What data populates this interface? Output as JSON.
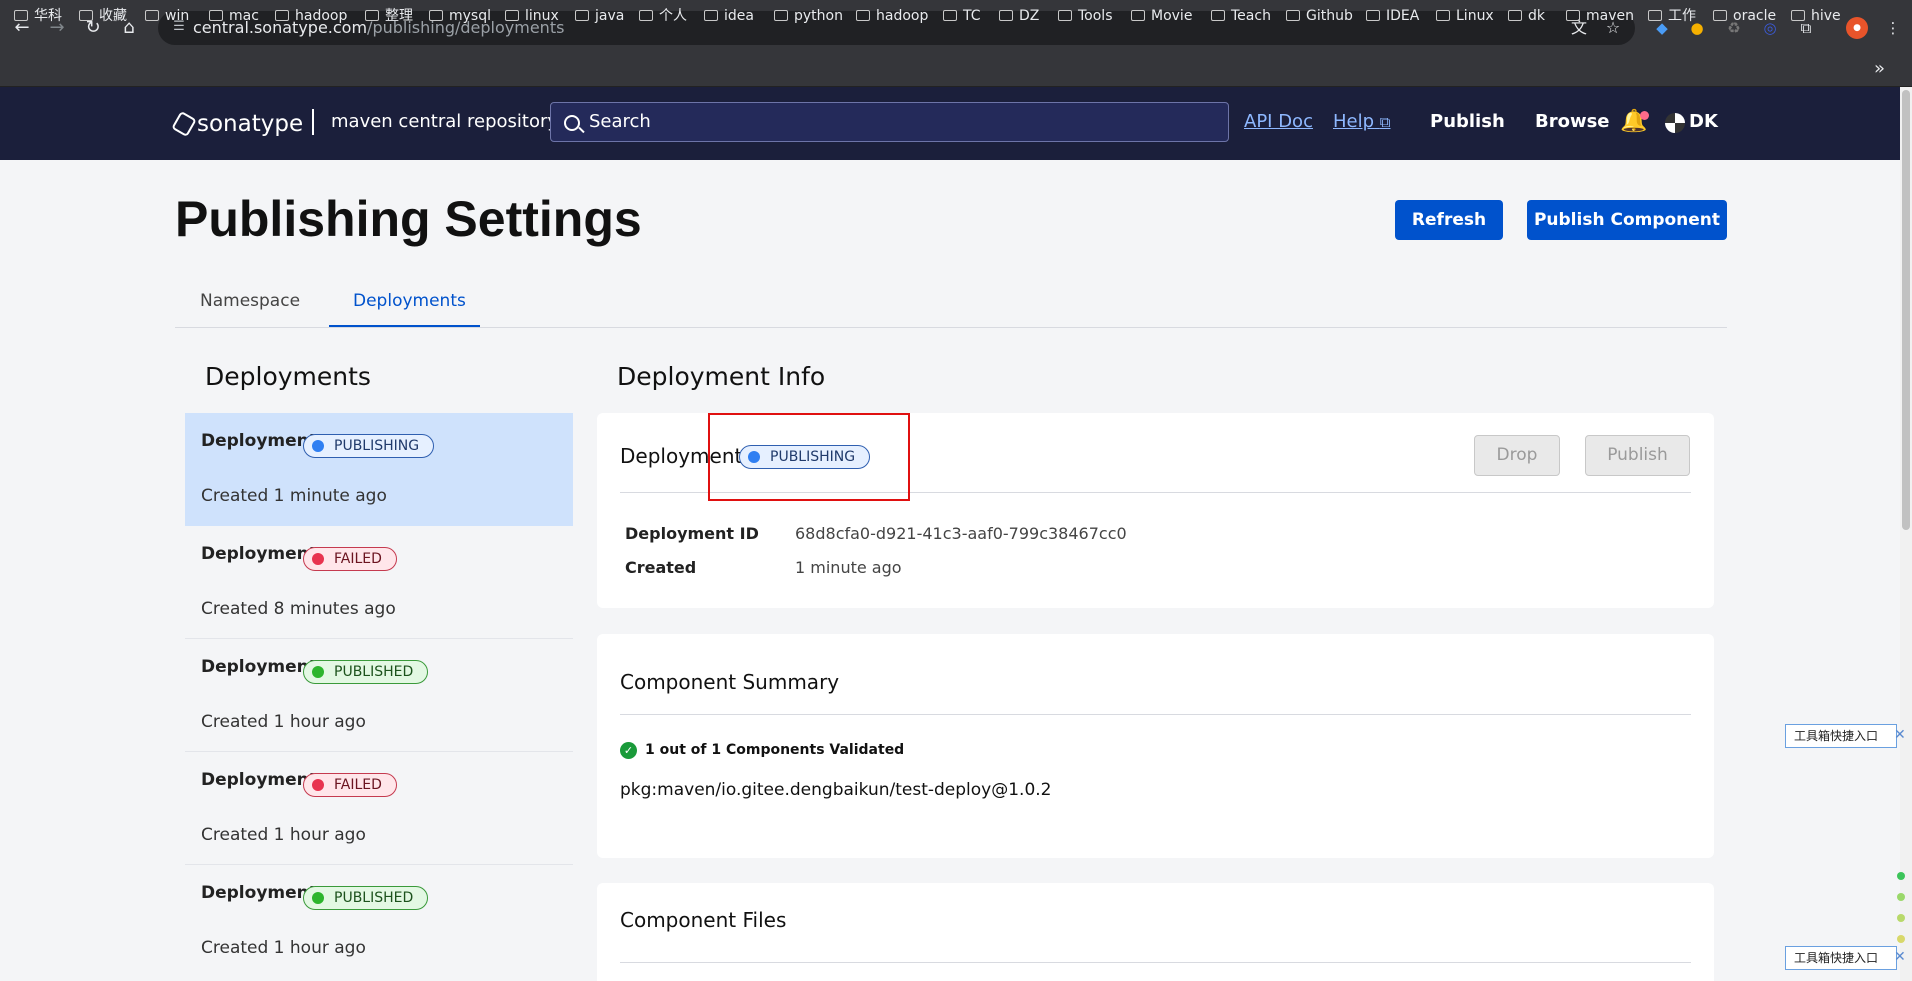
{
  "browser": {
    "url_host": "central.sonatype.com",
    "url_path": "/publishing/deployments",
    "bookmarks": [
      "华科",
      "收藏",
      "win",
      "mac",
      "hadoop",
      "整理",
      "mysql",
      "linux",
      "java",
      "个人",
      "idea",
      "python",
      "hadoop",
      "TC",
      "DZ",
      "Tools",
      "Movie",
      "Teach",
      "Github",
      "IDEA",
      "Linux",
      "dk",
      "maven",
      "工作",
      "oracle",
      "hive"
    ],
    "more": "»"
  },
  "header": {
    "logo": "sonatype",
    "subtitle": "maven central repository",
    "search_placeholder": "Search",
    "api_doc": "API Doc",
    "help": "Help",
    "publish": "Publish",
    "browse": "Browse",
    "user": "DK"
  },
  "page": {
    "title": "Publishing Settings",
    "refresh": "Refresh",
    "publish_component": "Publish Component",
    "tabs": [
      "Namespace",
      "Deployments"
    ]
  },
  "deployments": {
    "heading": "Deployments",
    "items": [
      {
        "label": "Deployment",
        "status": "PUBLISHING",
        "created": "Created 1 minute ago"
      },
      {
        "label": "Deployment",
        "status": "FAILED",
        "created": "Created 8 minutes ago"
      },
      {
        "label": "Deployment",
        "status": "PUBLISHED",
        "created": "Created 1 hour ago"
      },
      {
        "label": "Deployment",
        "status": "FAILED",
        "created": "Created 1 hour ago"
      },
      {
        "label": "Deployment",
        "status": "PUBLISHED",
        "created": "Created 1 hour ago"
      }
    ]
  },
  "info": {
    "heading": "Deployment Info",
    "card_title": "Deployment",
    "status": "PUBLISHING",
    "drop": "Drop",
    "publish": "Publish",
    "id_label": "Deployment ID",
    "id_value": "68d8cfa0-d921-41c3-aaf0-799c38467cc0",
    "created_label": "Created",
    "created_value": "1 minute ago"
  },
  "summary": {
    "title": "Component Summary",
    "validated": "1 out of 1 Components Validated",
    "pkg": "pkg:maven/io.gitee.dengbaikun/test-deploy@1.0.2"
  },
  "files": {
    "title": "Component Files"
  },
  "overlay": {
    "tool_label": "工具箱快捷入口",
    "close": "✕"
  }
}
